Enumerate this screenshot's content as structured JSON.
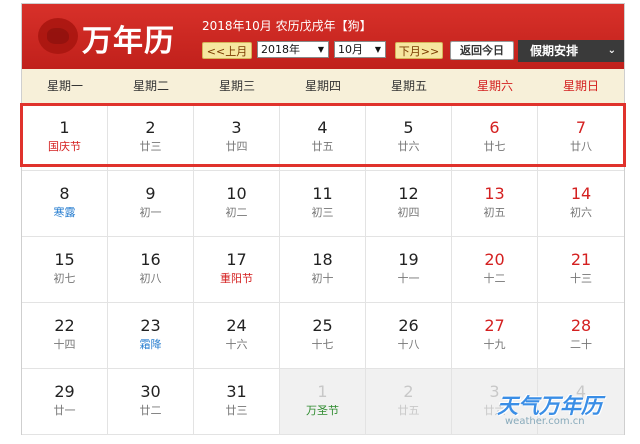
{
  "header": {
    "logo_text": "万年历",
    "lunar_info": "2018年10月 农历戊戌年【狗】",
    "prev_month": "<<上月",
    "year_select": "2018年",
    "month_select": "10月",
    "next_month": "下月>>",
    "today": "返回今日",
    "holiday_menu": "假期安排"
  },
  "weekdays": [
    "星期一",
    "星期二",
    "星期三",
    "星期四",
    "星期五",
    "星期六",
    "星期日"
  ],
  "weeks": [
    [
      {
        "day": "1",
        "lunar": "国庆节"
      },
      {
        "day": "2",
        "lunar": "廿三"
      },
      {
        "day": "3",
        "lunar": "廿四"
      },
      {
        "day": "4",
        "lunar": "廿五"
      },
      {
        "day": "5",
        "lunar": "廿六"
      },
      {
        "day": "6",
        "lunar": "廿七"
      },
      {
        "day": "7",
        "lunar": "廿八"
      }
    ],
    [
      {
        "day": "8",
        "lunar": "寒露"
      },
      {
        "day": "9",
        "lunar": "初一"
      },
      {
        "day": "10",
        "lunar": "初二"
      },
      {
        "day": "11",
        "lunar": "初三"
      },
      {
        "day": "12",
        "lunar": "初四"
      },
      {
        "day": "13",
        "lunar": "初五"
      },
      {
        "day": "14",
        "lunar": "初六"
      }
    ],
    [
      {
        "day": "15",
        "lunar": "初七"
      },
      {
        "day": "16",
        "lunar": "初八"
      },
      {
        "day": "17",
        "lunar": "重阳节"
      },
      {
        "day": "18",
        "lunar": "初十"
      },
      {
        "day": "19",
        "lunar": "十一"
      },
      {
        "day": "20",
        "lunar": "十二"
      },
      {
        "day": "21",
        "lunar": "十三"
      }
    ],
    [
      {
        "day": "22",
        "lunar": "十四"
      },
      {
        "day": "23",
        "lunar": "霜降"
      },
      {
        "day": "24",
        "lunar": "十六"
      },
      {
        "day": "25",
        "lunar": "十七"
      },
      {
        "day": "26",
        "lunar": "十八"
      },
      {
        "day": "27",
        "lunar": "十九"
      },
      {
        "day": "28",
        "lunar": "二十"
      }
    ],
    [
      {
        "day": "29",
        "lunar": "廿一"
      },
      {
        "day": "30",
        "lunar": "廿二"
      },
      {
        "day": "31",
        "lunar": "廿三"
      },
      {
        "day": "1",
        "lunar": "万圣节"
      },
      {
        "day": "2",
        "lunar": "廿五"
      },
      {
        "day": "3",
        "lunar": "廿六"
      },
      {
        "day": "4",
        "lunar": ""
      }
    ]
  ],
  "colors": {
    "header_red": "#c0201b",
    "weekend_red": "#d42020",
    "solar_term_blue": "#2a7fd0",
    "highlight_border": "#e0322c",
    "weekday_bar": "#f7f0d9"
  },
  "watermark": {
    "title": "天气万年历",
    "sub": "weather.com.cn"
  }
}
